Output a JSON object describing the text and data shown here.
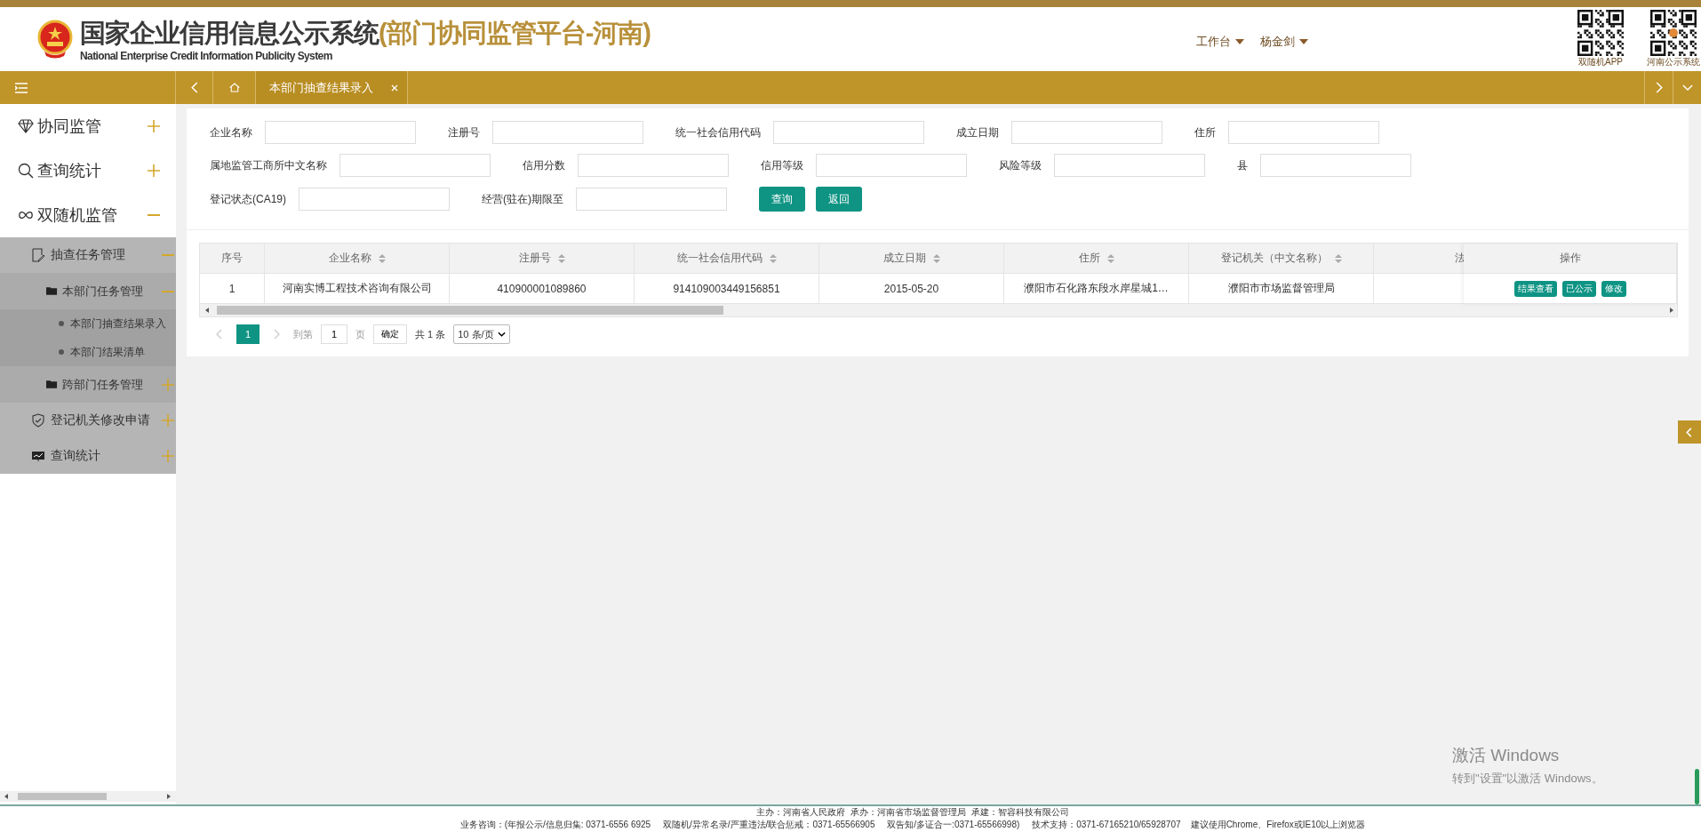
{
  "header": {
    "title": "国家企业信用信息公示系统",
    "subtitle": "(部门协同监管平台-河南)",
    "english": "National Enterprise Credit Information Publicity System",
    "menus": [
      "工作台",
      "杨金剑"
    ],
    "qr_codes": [
      {
        "caption": "双随机APP"
      },
      {
        "caption": "河南公示系统"
      }
    ]
  },
  "tabs": [
    {
      "label": "本部门抽查结果录入",
      "selected": true
    }
  ],
  "sidebar": {
    "items": [
      {
        "label": "协同监管",
        "expanded": false
      },
      {
        "label": "查询统计",
        "expanded": false
      },
      {
        "label": "双随机监管",
        "expanded": true,
        "children": [
          {
            "label": "抽查任务管理",
            "expanded": true,
            "children": [
              {
                "label": "本部门任务管理",
                "expanded": true,
                "children": [
                  {
                    "label": "本部门抽查结果录入"
                  },
                  {
                    "label": "本部门结果清单"
                  }
                ]
              },
              {
                "label": "跨部门任务管理",
                "expanded": false
              }
            ]
          },
          {
            "label": "登记机关修改申请",
            "expanded": false
          },
          {
            "label": "查询统计",
            "expanded": false
          }
        ]
      }
    ]
  },
  "filters": [
    [
      {
        "label": "企业名称"
      },
      {
        "label": "注册号"
      },
      {
        "label": "统一社会信用代码"
      },
      {
        "label": "成立日期"
      },
      {
        "label": "住所"
      }
    ],
    [
      {
        "label": "属地监管工商所中文名称"
      },
      {
        "label": "信用分数"
      },
      {
        "label": "信用等级"
      },
      {
        "label": "风险等级"
      },
      {
        "label": "县"
      }
    ],
    [
      {
        "label": "登记状态(CA19)"
      },
      {
        "label": "经营(驻在)期限至"
      }
    ]
  ],
  "filter_buttons": [
    "查询",
    "返回"
  ],
  "table": {
    "columns": [
      {
        "label": "序号",
        "sortable": false
      },
      {
        "label": "企业名称",
        "sortable": true
      },
      {
        "label": "注册号",
        "sortable": true
      },
      {
        "label": "统一社会信用代码",
        "sortable": true
      },
      {
        "label": "成立日期",
        "sortable": true
      },
      {
        "label": "住所",
        "sortable": true
      },
      {
        "label": "登记机关（中文名称）",
        "sortable": true
      },
      {
        "label": "法",
        "sortable": false
      }
    ],
    "action_column": "操作",
    "rows": [
      {
        "cells": [
          "1",
          "河南实博工程技术咨询有限公司",
          "410900001089860",
          "914109003449156851",
          "2015-05-20",
          "濮阳市石化路东段水岸星城1…",
          "濮阳市市场监督管理局",
          ""
        ],
        "actions": [
          "结果查看",
          "已公示",
          "修改"
        ]
      }
    ]
  },
  "pagination": {
    "pages": [
      {
        "label": "1",
        "selected": true
      }
    ],
    "goto_label": "到第",
    "goto_value": "1",
    "page_unit": "页",
    "confirm": "确定",
    "total": "共 1 条",
    "page_size": "10 条/页"
  },
  "os_notice": {
    "title": "激活 Windows",
    "text": "转到\"设置\"以激活 Windows。"
  },
  "footer": {
    "lines": [
      "主办：河南省人民政府  承办：河南省市场监督管理局  承建：智容科技有限公司",
      "业务咨询：(年报公示/信息归集: 0371-6556 6925     双随机/异常名录/严重违法/联合惩戒：0371-65566905     双告知/多证合一:0371-65566998)     技术支持：0371-67165210/65928707    建议使用Chrome、Firefox或IE10以上浏览器"
    ]
  }
}
